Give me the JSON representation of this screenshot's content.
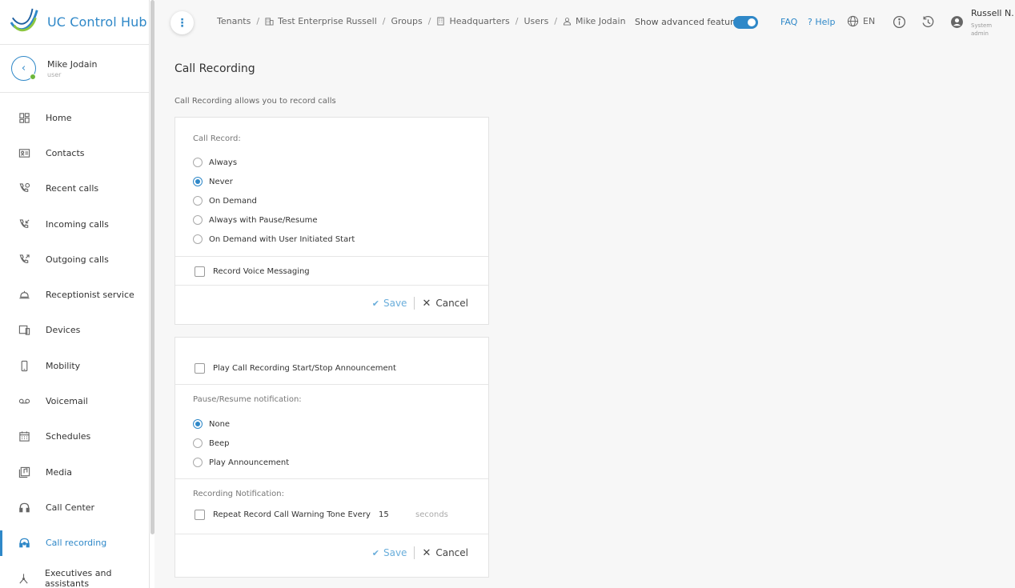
{
  "app": {
    "title": "UC Control Hub"
  },
  "user": {
    "name": "Mike Jodain",
    "role": "user"
  },
  "sidebar": {
    "items": [
      {
        "label": "Home",
        "icon": "dashboard-icon"
      },
      {
        "label": "Contacts",
        "icon": "contact-card-icon"
      },
      {
        "label": "Recent calls",
        "icon": "phone-recent-icon"
      },
      {
        "label": "Incoming calls",
        "icon": "phone-incoming-icon"
      },
      {
        "label": "Outgoing calls",
        "icon": "phone-outgoing-icon"
      },
      {
        "label": "Receptionist service",
        "icon": "desk-bell-icon"
      },
      {
        "label": "Devices",
        "icon": "devices-icon"
      },
      {
        "label": "Mobility",
        "icon": "mobile-icon"
      },
      {
        "label": "Voicemail",
        "icon": "voicemail-icon"
      },
      {
        "label": "Schedules",
        "icon": "calendar-icon"
      },
      {
        "label": "Media",
        "icon": "media-icon"
      },
      {
        "label": "Call Center",
        "icon": "headset-icon"
      },
      {
        "label": "Call recording",
        "icon": "call-recording-icon",
        "active": true
      },
      {
        "label": "Executives and assistants",
        "icon": "executive-icon"
      }
    ]
  },
  "breadcrumb": {
    "items": [
      "Tenants",
      "Test Enterprise Russell",
      "Groups",
      "Headquarters",
      "Users",
      "Mike Jodain"
    ]
  },
  "header": {
    "advanced_label": "Show advanced features",
    "advanced_on": true,
    "faq": "FAQ",
    "help": "Help",
    "lang": "EN",
    "account_name": "Russell N.",
    "account_role": "System admin"
  },
  "page": {
    "title": "Call Recording",
    "description": "Call Recording allows you to record calls"
  },
  "card1": {
    "call_record_label": "Call Record:",
    "options": [
      "Always",
      "Never",
      "On Demand",
      "Always with Pause/Resume",
      "On Demand with User Initiated Start"
    ],
    "selected": "Never",
    "record_voice_messaging": "Record Voice Messaging",
    "save": "Save",
    "cancel": "Cancel"
  },
  "card2": {
    "play_announcement": "Play Call Recording Start/Stop Announcement",
    "pause_label": "Pause/Resume notification:",
    "pause_options": [
      "None",
      "Beep",
      "Play Announcement"
    ],
    "pause_selected": "None",
    "recording_label": "Recording Notification:",
    "repeat_label": "Repeat Record Call Warning Tone Every",
    "repeat_value": "15",
    "repeat_unit": "seconds",
    "save": "Save",
    "cancel": "Cancel"
  },
  "colors": {
    "accent": "#2f88c8",
    "status_online": "#6cb63b"
  }
}
